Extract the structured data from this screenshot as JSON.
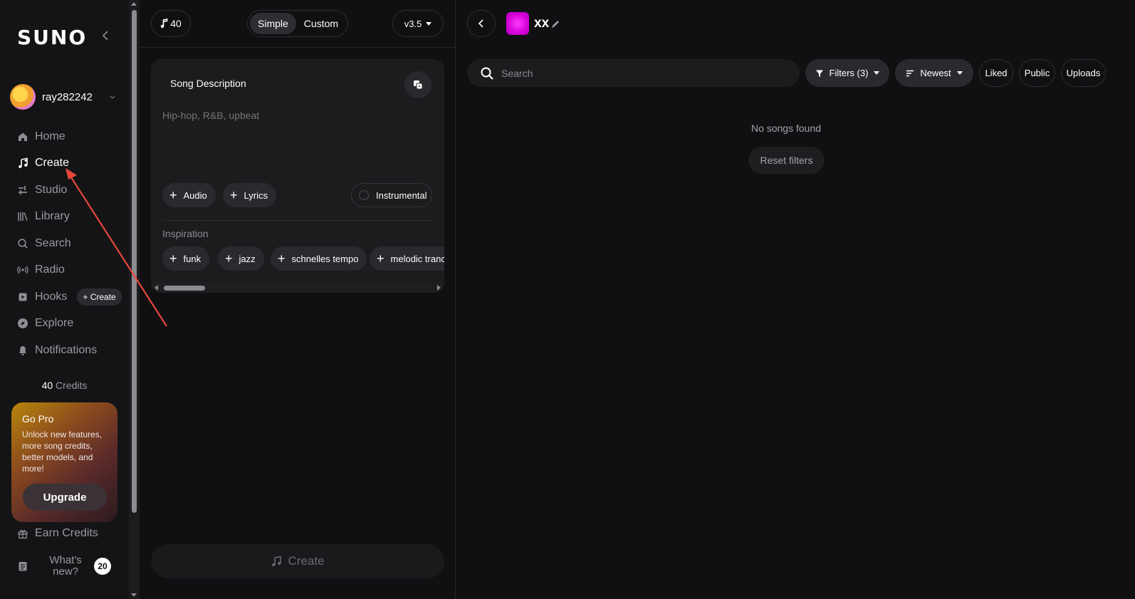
{
  "sidebar": {
    "logo": "SUNO",
    "username": "ray282242",
    "nav": [
      {
        "label": "Home",
        "icon": "home-icon"
      },
      {
        "label": "Create",
        "icon": "music-note-icon"
      },
      {
        "label": "Studio",
        "icon": "studio-icon"
      },
      {
        "label": "Library",
        "icon": "library-icon"
      },
      {
        "label": "Search",
        "icon": "search-icon"
      },
      {
        "label": "Radio",
        "icon": "radio-icon"
      },
      {
        "label": "Hooks",
        "icon": "hooks-icon"
      },
      {
        "label": "Explore",
        "icon": "compass-icon"
      },
      {
        "label": "Notifications",
        "icon": "bell-icon"
      }
    ],
    "hooks_create": "+ Create",
    "credits_count": "40",
    "credits_label": "Credits",
    "gopro": {
      "title": "Go Pro",
      "text": "Unlock new features, more song credits, better models, and more!",
      "button": "Upgrade"
    },
    "earn_credits": "Earn Credits",
    "whats_new": "What's new?",
    "whats_new_badge": "20"
  },
  "create": {
    "credits_pill": "40",
    "mode_simple": "Simple",
    "mode_custom": "Custom",
    "version": "v3.5",
    "song_description_title": "Song Description",
    "song_description_placeholder": "Hip-hop, R&B, upbeat",
    "audio_label": "Audio",
    "lyrics_label": "Lyrics",
    "instrumental_label": "Instrumental",
    "inspiration_title": "Inspiration",
    "inspiration": [
      "funk",
      "jazz",
      "schnelles tempo",
      "melodic trance"
    ],
    "create_button": "Create"
  },
  "library": {
    "workspace_title": "xx",
    "search_placeholder": "Search",
    "filters_label": "Filters (3)",
    "sort_label": "Newest",
    "liked_label": "Liked",
    "public_label": "Public",
    "uploads_label": "Uploads",
    "empty_message": "No songs found",
    "reset_filters": "Reset filters"
  },
  "colors": {
    "background": "#101012",
    "annotation_arrow": "#e8473a",
    "workspace_thumb": "#d400d8"
  }
}
